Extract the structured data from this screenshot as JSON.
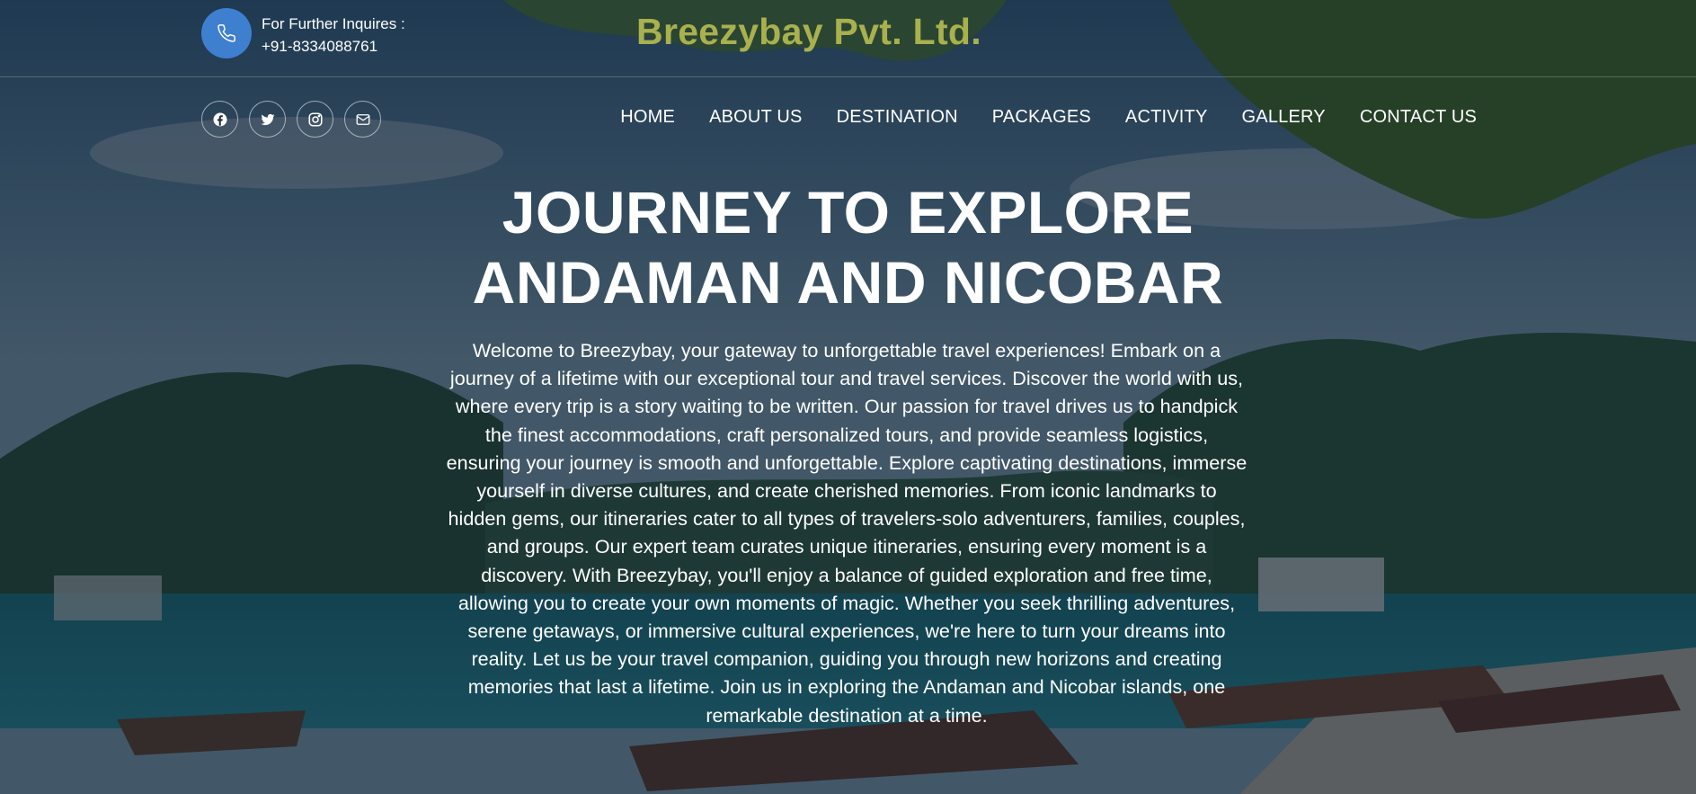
{
  "contact": {
    "label": "For Further Inquires :",
    "phone": "+91-8334088761"
  },
  "brand": "Breezybay Pvt. Ltd.",
  "social": [
    "facebook-icon",
    "twitter-icon",
    "instagram-icon",
    "mail-icon"
  ],
  "nav": {
    "items": [
      "HOME",
      "ABOUT US",
      "DESTINATION",
      "PACKAGES",
      "ACTIVITY",
      "GALLERY",
      "CONTACT US"
    ]
  },
  "hero": {
    "title_line1": "JOURNEY TO EXPLORE",
    "title_line2": "ANDAMAN AND NICOBAR",
    "description": "Welcome to Breezybay, your gateway to unforgettable travel experiences! Embark on a journey of a lifetime with our exceptional tour and travel services. Discover the world with us, where every trip is a story waiting to be written. Our passion for travel drives us to handpick the finest accommodations, craft personalized tours, and provide seamless logistics, ensuring your journey is smooth and unforgettable. Explore captivating destinations, immerse yourself in diverse cultures, and create cherished memories. From iconic landmarks to hidden gems, our itineraries cater to all types of travelers-solo adventurers, families, couples, and groups. Our expert team curates unique itineraries, ensuring every moment is a discovery. With Breezybay, you'll enjoy a balance of guided exploration and free time, allowing you to create your own moments of magic. Whether you seek thrilling adventures, serene getaways, or immersive cultural experiences, we're here to turn your dreams into reality. Let us be your travel companion, guiding you through new horizons and creating memories that last a lifetime. Join us in exploring the Andaman and Nicobar islands, one remarkable destination at a time."
  },
  "colors": {
    "brand": "#a9b04e",
    "phone_circle": "#3f7fd0"
  }
}
